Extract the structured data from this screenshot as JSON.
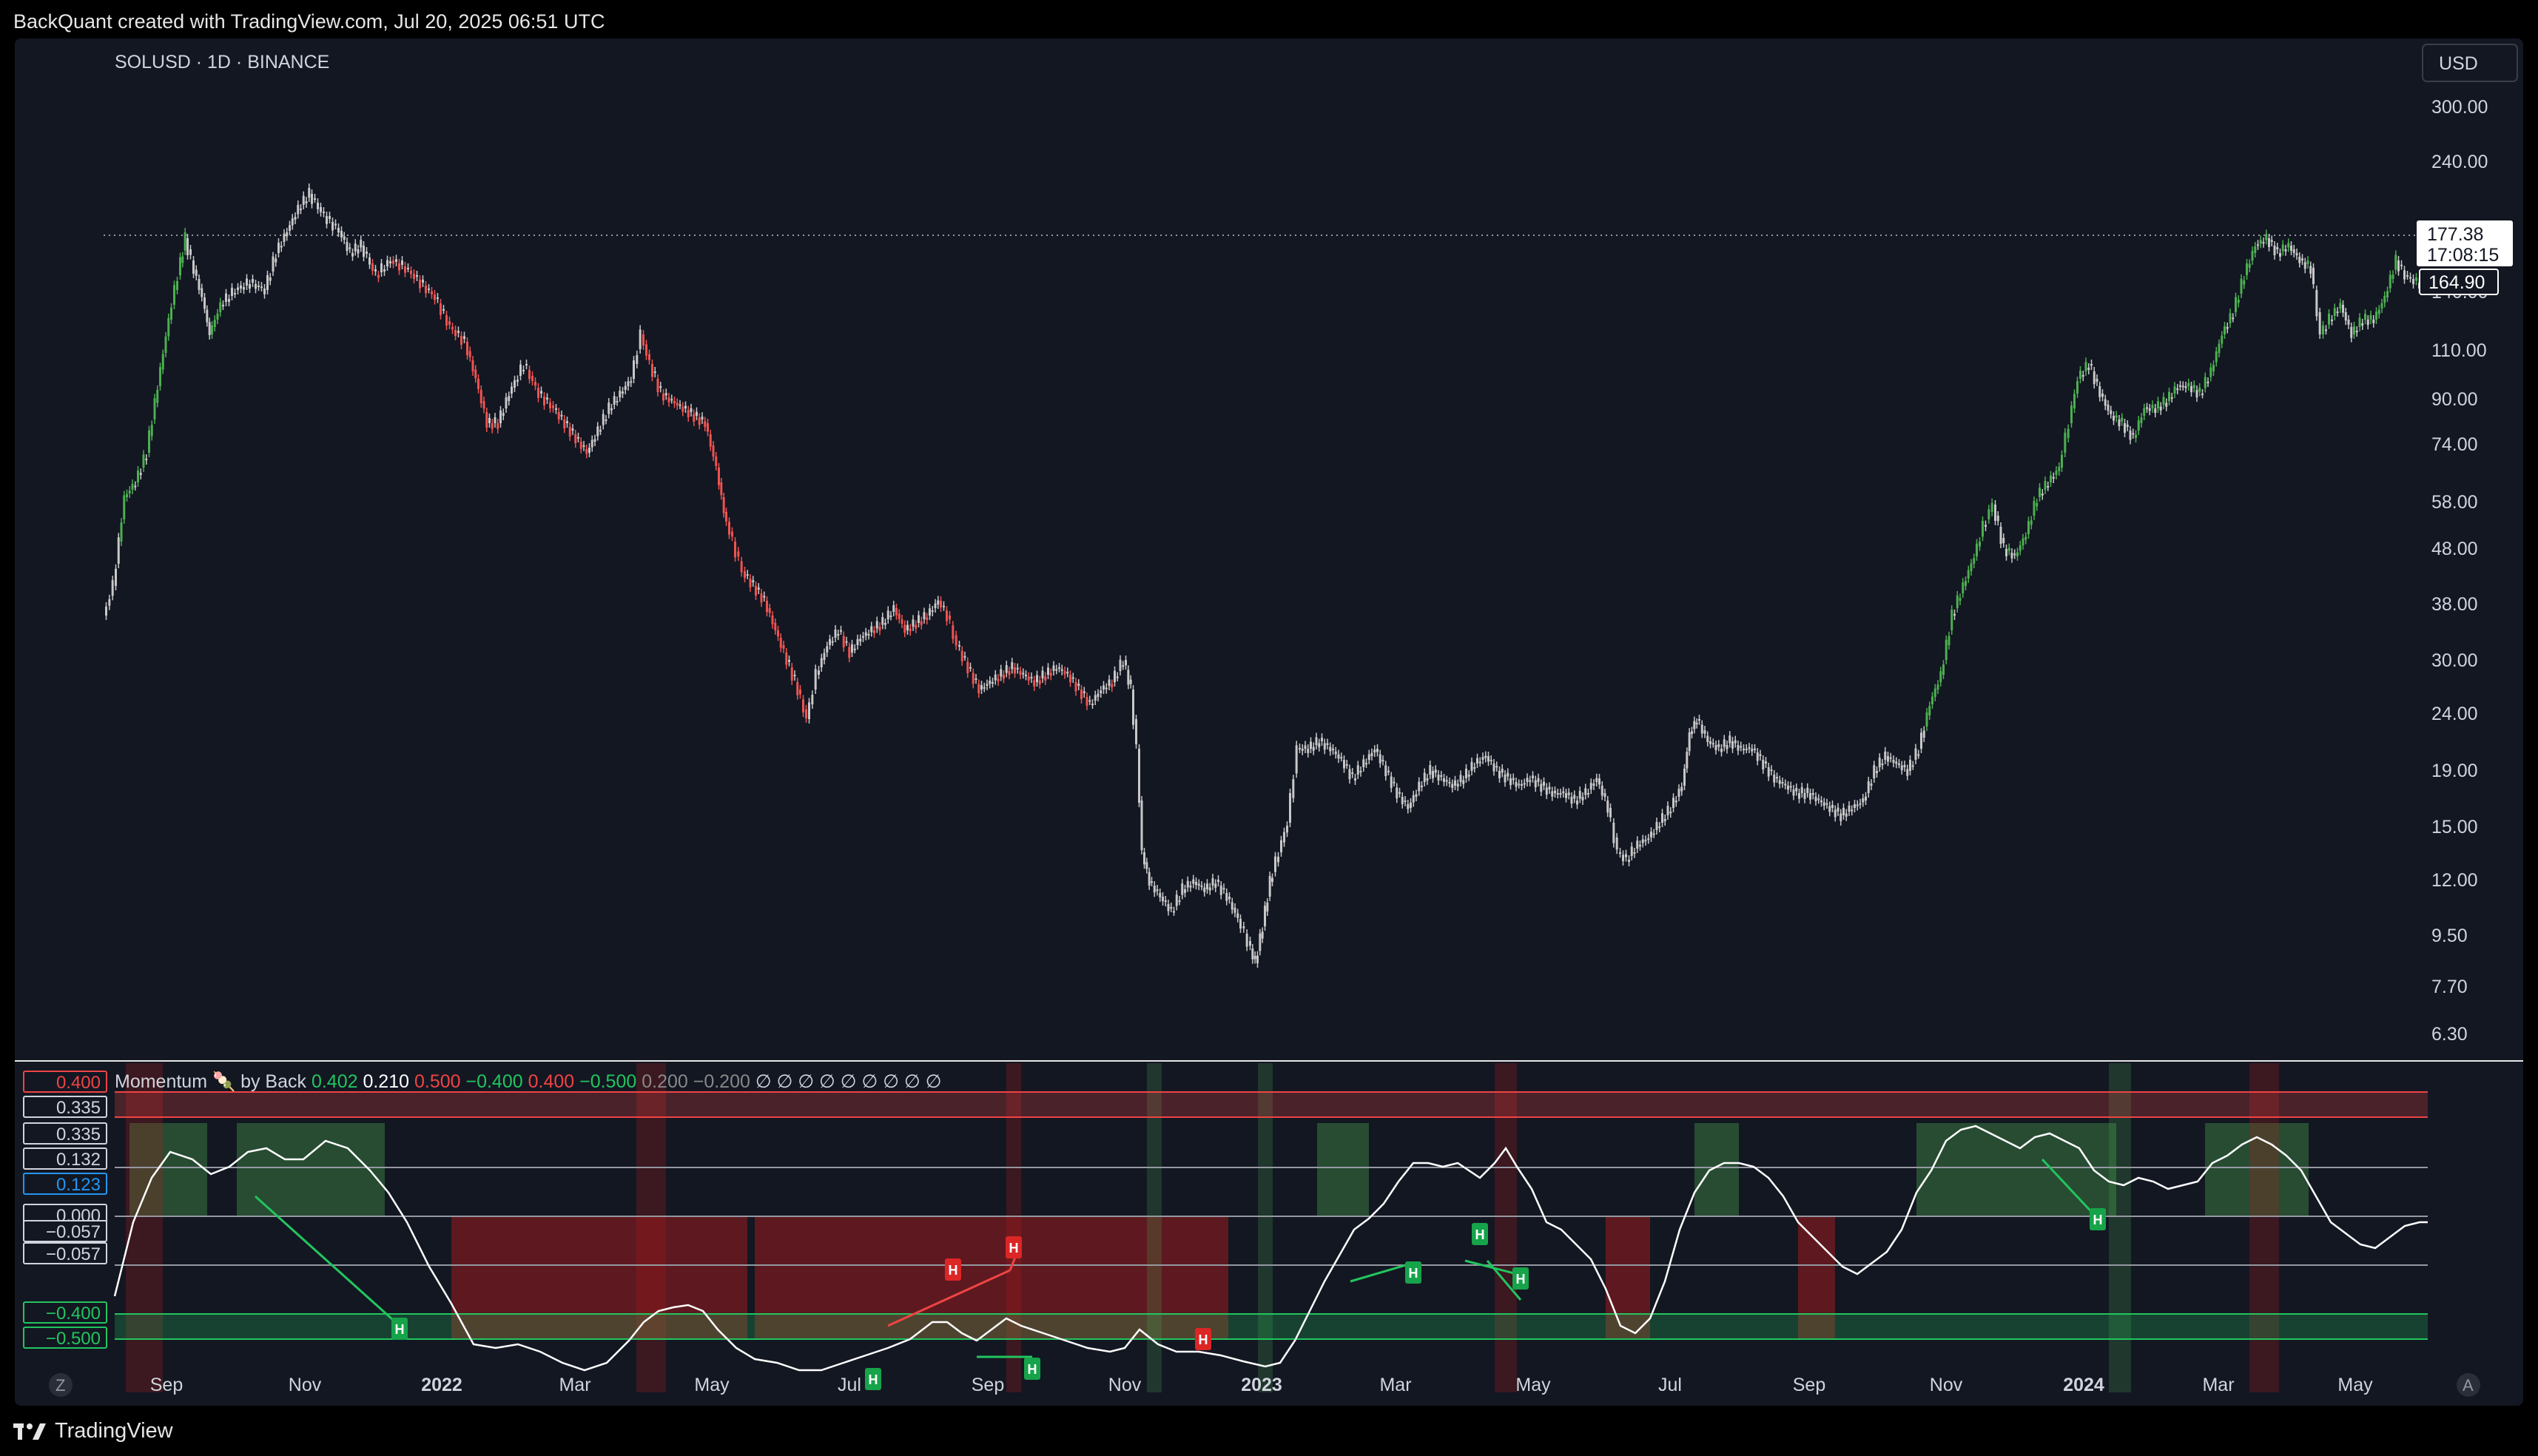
{
  "header": {
    "attribution": "BackQuant created with TradingView.com, Jul 20, 2025 06:51 UTC"
  },
  "symbol": {
    "title": "SOLUSD · 1D · BINANCE",
    "currency": "USD"
  },
  "price_axis": {
    "ticks": [
      "300.00",
      "240.00",
      "140.00",
      "110.00",
      "90.00",
      "74.00",
      "58.00",
      "48.00",
      "38.00",
      "30.00",
      "24.00",
      "19.00",
      "15.00",
      "12.00",
      "9.50",
      "7.70",
      "6.30"
    ],
    "last_price": "177.38",
    "countdown": "17:08:15",
    "prev_level": "164.90"
  },
  "time_axis": {
    "labels": [
      "Sep",
      "Nov",
      "2022",
      "Mar",
      "May",
      "Jul",
      "Sep",
      "Nov",
      "2023",
      "Mar",
      "May",
      "Jul",
      "Sep",
      "Nov",
      "2024",
      "Mar",
      "May"
    ],
    "year_labels": [
      "2022",
      "2023",
      "2024"
    ]
  },
  "indicator": {
    "name": "Momentum",
    "emoji": "🍡",
    "by": "by Back",
    "values": [
      "0.402",
      "0.210",
      "0.500",
      "−0.400",
      "0.400",
      "−0.500",
      "0.200",
      "−0.200",
      "∅",
      "∅",
      "∅",
      "∅",
      "∅",
      "∅",
      "∅",
      "∅",
      "∅"
    ],
    "value_colors": [
      "#22c55e",
      "#ffffff",
      "#ef4444",
      "#22c55e",
      "#ef4444",
      "#22c55e",
      "#888888",
      "#888888",
      "#d1d4dc",
      "#d1d4dc",
      "#d1d4dc",
      "#d1d4dc",
      "#d1d4dc",
      "#d1d4dc",
      "#d1d4dc",
      "#d1d4dc",
      "#d1d4dc"
    ],
    "axis_labels": [
      {
        "text": "0.400",
        "border": "#ef4444",
        "fill": "#131722",
        "color": "#ef4444"
      },
      {
        "text": "0.335",
        "border": "#d1d4dc",
        "fill": "#131722",
        "color": "#d1d4dc"
      },
      {
        "text": "0.335",
        "border": "#d1d4dc",
        "fill": "#131722",
        "color": "#d1d4dc"
      },
      {
        "text": "0.132",
        "border": "#d1d4dc",
        "fill": "#131722",
        "color": "#d1d4dc"
      },
      {
        "text": "0.123",
        "border": "#2196f3",
        "fill": "#131722",
        "color": "#2196f3"
      },
      {
        "text": "0.000",
        "border": "#d1d4dc",
        "fill": "#131722",
        "color": "#d1d4dc"
      },
      {
        "text": "−0.057",
        "border": "#d1d4dc",
        "fill": "#131722",
        "color": "#d1d4dc"
      },
      {
        "text": "−0.057",
        "border": "#d1d4dc",
        "fill": "#131722",
        "color": "#d1d4dc"
      },
      {
        "text": "−0.400",
        "border": "#22c55e",
        "fill": "#131722",
        "color": "#22c55e"
      },
      {
        "text": "−0.500",
        "border": "#22c55e",
        "fill": "#131722",
        "color": "#22c55e"
      }
    ]
  },
  "controls": {
    "zoom_left": "Z",
    "auto_scale": "A"
  },
  "footer": {
    "brand": "TradingView"
  },
  "colors": {
    "background": "#131722",
    "up": "#4caf50",
    "down": "#ef5350",
    "neutral_candle": "#c8c8c8",
    "momentum_line": "#ffffff"
  }
}
